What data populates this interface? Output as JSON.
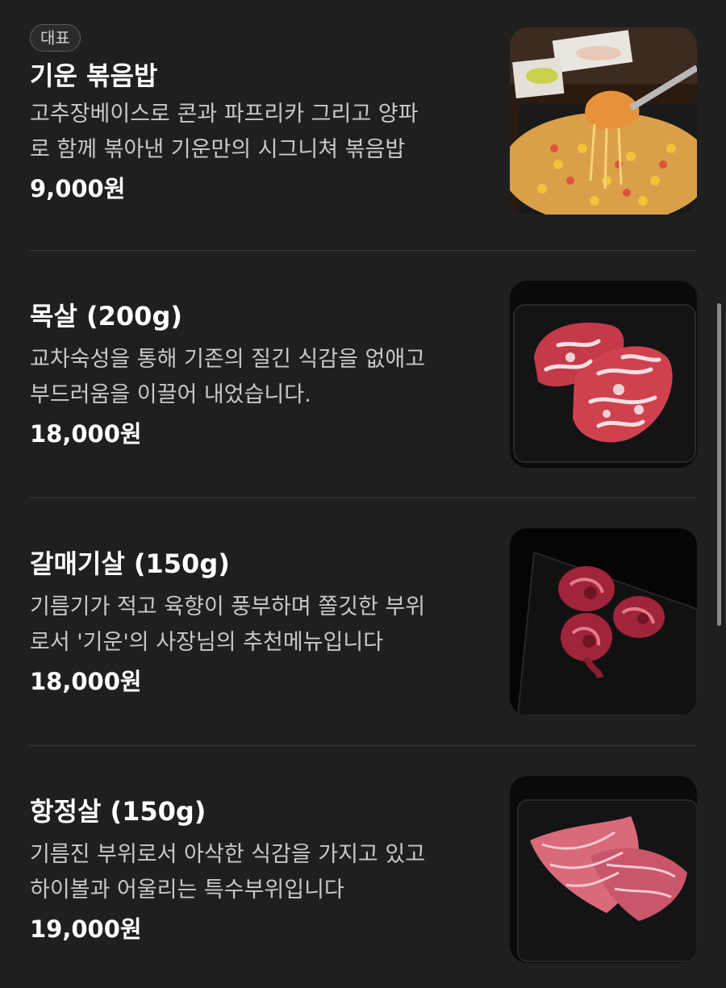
{
  "menu": {
    "items": [
      {
        "badge": "대표",
        "name": "기운 볶음밥",
        "desc_lines": [
          "고추장베이스로 콘과 파프리카 그리고 양파",
          "로 함께 볶아낸 기운만의 시그니쳐 볶음밥"
        ],
        "price": "9,000원",
        "image": "fried-rice-photo"
      },
      {
        "name": "목살 (200g)",
        "desc_lines": [
          "교차숙성을 통해 기존의 질긴 식감을 없애고",
          "부드러움을 이끌어 내었습니다."
        ],
        "price": "18,000원",
        "image": "pork-neck-photo"
      },
      {
        "name": "갈매기살 (150g)",
        "desc_lines": [
          "기름기가 적고 육향이 풍부하며 쫄깃한 부위",
          "로서 '기운'의 사장님의 추천메뉴입니다"
        ],
        "price": "18,000원",
        "image": "skirt-meat-photo"
      },
      {
        "name": "항정살 (150g)",
        "desc_lines": [
          "기름진 부위로서 아삭한 식감을 가지고 있고",
          "하이볼과 어울리는 특수부위입니다"
        ],
        "price": "19,000원",
        "image": "pork-jowl-photo"
      }
    ]
  },
  "colors": {
    "background": "#1f1f1f",
    "divider": "#3a3a3a",
    "text_primary": "#ffffff",
    "text_secondary": "#c8c8c8"
  }
}
